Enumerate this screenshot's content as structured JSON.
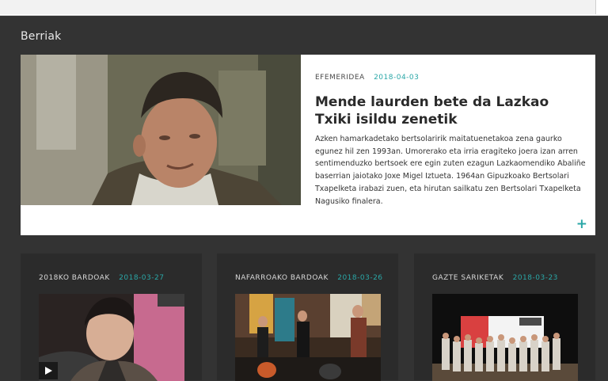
{
  "section": {
    "title": "Berriak"
  },
  "featured": {
    "category": "EFEMERIDEA",
    "date": "2018-04-03",
    "title": "Mende laurden bete da Lazkao Txiki isildu zenetik",
    "excerpt": "Azken hamarkadetako bertsolaririk maitatuenetakoa zena gaurko egunez hil zen 1993an. Umorerako eta irria eragiteko joera izan arren sentimenduzko bertsoek ere egin zuten ezagun Lazkaomendiko Abaliñe baserrian jaiotako Joxe Migel Iztueta. 1964an Gipuzkoako Bertsolari Txapelketa irabazi zuen, eta hirutan sailkatu zen Bertsolari Txapelketa Nagusiko finalera.",
    "more_icon": "+"
  },
  "cards": [
    {
      "category": "2018KO BARDOAK",
      "date": "2018-03-27"
    },
    {
      "category": "NAFARROAKO BARDOAK",
      "date": "2018-03-26"
    },
    {
      "category": "GAZTE SARIKETAK",
      "date": "2018-03-23"
    }
  ],
  "colors": {
    "accent": "#2aa7a7",
    "background": "#333333",
    "card": "#2b2b2b"
  }
}
